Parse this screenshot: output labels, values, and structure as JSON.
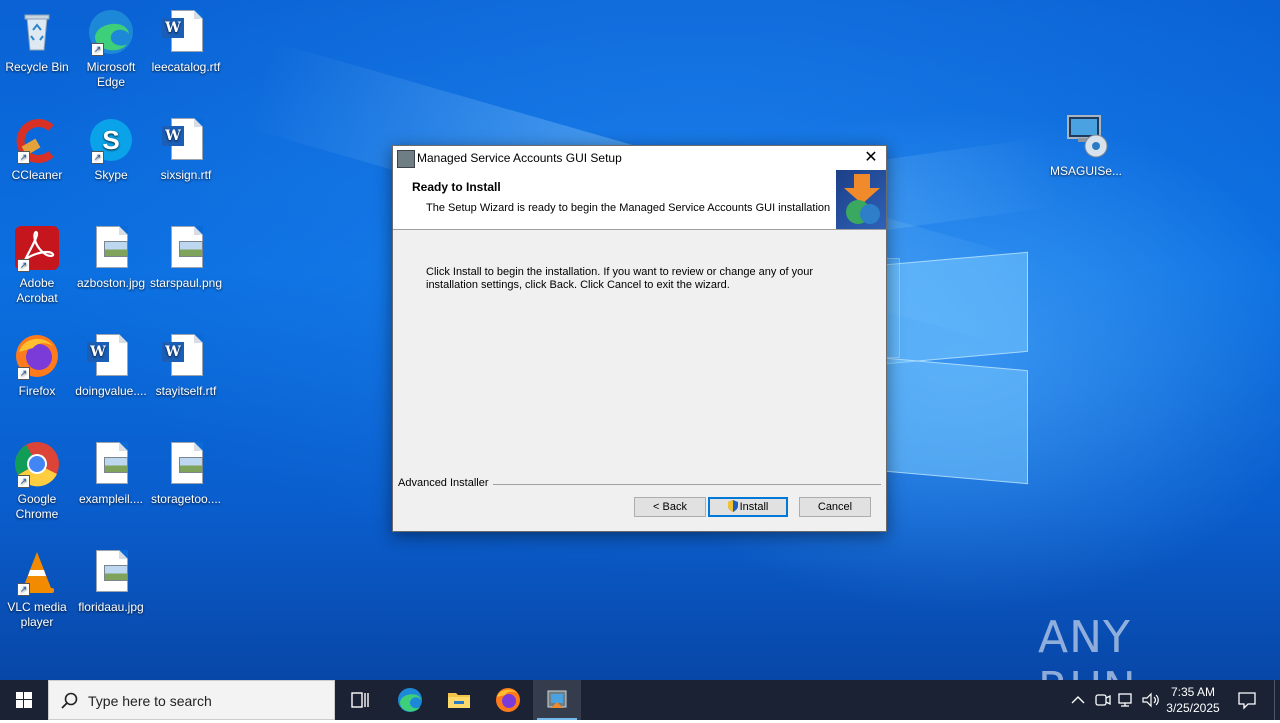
{
  "desktop": {
    "icons": [
      {
        "label": "Recycle Bin"
      },
      {
        "label": "Microsoft Edge"
      },
      {
        "label": "leecatalog.rtf"
      },
      {
        "label": "CCleaner"
      },
      {
        "label": "Skype"
      },
      {
        "label": "sixsign.rtf"
      },
      {
        "label": "Adobe Acrobat"
      },
      {
        "label": "azboston.jpg"
      },
      {
        "label": "starspaul.png"
      },
      {
        "label": "Firefox"
      },
      {
        "label": "doingvalue...."
      },
      {
        "label": "stayitself.rtf"
      },
      {
        "label": "Google Chrome"
      },
      {
        "label": "exampleil...."
      },
      {
        "label": "storagetoo...."
      },
      {
        "label": "VLC media player"
      },
      {
        "label": "floridaau.jpg"
      },
      {
        "label": "MSAGUISe..."
      }
    ],
    "watermark": "ANY RUN"
  },
  "dialog": {
    "title": "Managed Service Accounts GUI Setup",
    "close_glyph": "✕",
    "heading": "Ready to Install",
    "subheading": "The Setup Wizard is ready to begin the Managed Service Accounts GUI installation",
    "body_line1": "Click Install to begin the installation.  If you want to review or change any of your",
    "body_line2": "installation settings, click Back.  Click Cancel to exit the wizard.",
    "brand": "Advanced Installer",
    "back_label": "< Back",
    "install_label": "Install",
    "cancel_label": "Cancel"
  },
  "taskbar": {
    "search_placeholder": "Type here to search",
    "time": "7:35 AM",
    "date": "3/25/2025",
    "pinned": [
      "task-view-icon",
      "edge-icon",
      "file-explorer-icon",
      "firefox-icon",
      "installer-icon"
    ]
  },
  "colors": {
    "desktop_blue": "#0b6fe0",
    "taskbar": "#1a2233",
    "default_button_border": "#0078d7"
  }
}
